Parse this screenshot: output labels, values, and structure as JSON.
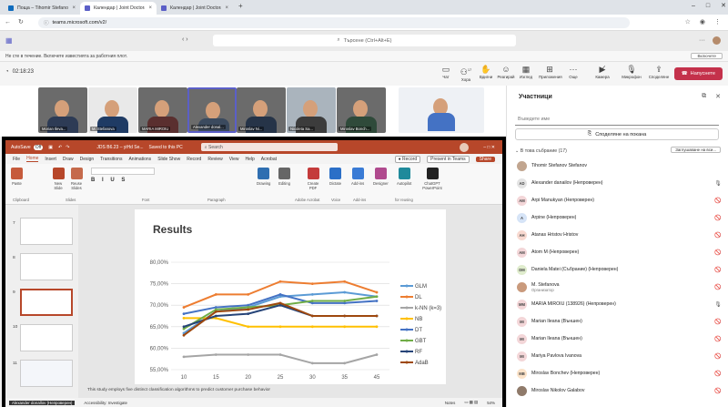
{
  "browser": {
    "tabs": [
      {
        "label": "Поща – Tihomir Stefanov Stefa",
        "active": false,
        "color": "#0f6cbd"
      },
      {
        "label": "Календар | Joint Doctoral T",
        "active": true,
        "color": "#5b5fc7"
      },
      {
        "label": "Календар | Joint Doctoral T",
        "active": false,
        "color": "#5b5fc7"
      }
    ],
    "new_tab": "+",
    "url": "teams.microsoft.com/v2/",
    "window_controls": [
      "–",
      "□",
      "✕"
    ]
  },
  "teams": {
    "search_placeholder": "Търсене (Ctrl+Alt+E)",
    "notice": "Не сте в течение. Включете известията за работния плот.",
    "notice_button": "Включете"
  },
  "meeting": {
    "timer": "02:18:23",
    "toolbar": [
      {
        "label": "Чат",
        "icon": "chat-icon"
      },
      {
        "label": "Хора",
        "icon": "people-icon",
        "badge": "17"
      },
      {
        "label": "Вдигни",
        "icon": "raise-hand-icon"
      },
      {
        "label": "Реагирай",
        "icon": "react-icon"
      },
      {
        "label": "Изглед",
        "icon": "view-icon"
      },
      {
        "label": "Приложения",
        "icon": "apps-icon"
      },
      {
        "label": "Още",
        "icon": "more-icon"
      },
      {
        "label": "Камера",
        "icon": "camera-icon"
      },
      {
        "label": "Микрофон",
        "icon": "mic-icon"
      },
      {
        "label": "Споделяне",
        "icon": "share-icon"
      }
    ],
    "leave_label": "Напуснете",
    "videos": [
      {
        "name": "Morian Ileva...",
        "bg": "#5e6d7a"
      },
      {
        "name": "M. Stefanova",
        "bg": "#d9d9d9"
      },
      {
        "name": "MARIA MIROIU",
        "bg": "#7a6a5c"
      },
      {
        "name": "Alexander donal...",
        "bg": "#8a8f95"
      },
      {
        "name": "Miroslav Ni...",
        "bg": "#6f7b86"
      },
      {
        "name": "Nicoleta Sa...",
        "bg": "#a8b1ba"
      },
      {
        "name": "Miroslav Bonch...",
        "bg": "#7d8a74"
      },
      {
        "name": "",
        "bg": "#f2f2f2"
      }
    ]
  },
  "powerpoint": {
    "autosave": "AutoSave",
    "autosave_state": "Off",
    "filename": "JDS B6.23 – yiHd Se...",
    "saved": "Saved to this PC",
    "search": "Search",
    "menu": [
      "File",
      "Home",
      "Insert",
      "Draw",
      "Design",
      "Transitions",
      "Animations",
      "Slide Show",
      "Record",
      "Review",
      "View",
      "Help",
      "Acrobat"
    ],
    "record_btn": "Record",
    "present_btn": "Present in Teams",
    "share_btn": "Share",
    "ribbon_groups": [
      {
        "label": "Paste",
        "color": "#c65b3c"
      },
      {
        "label": "New Slide",
        "color": "#b7472a"
      },
      {
        "label": "Reuse Slides",
        "color": "#c56a4b"
      },
      {
        "label": "Drawing",
        "color": "#2f6fb1"
      },
      {
        "label": "Editing",
        "color": "#666666"
      },
      {
        "label": "Create PDF",
        "color": "#c43b3b"
      },
      {
        "label": "Dictate",
        "color": "#2b6fc7"
      },
      {
        "label": "Add-ins",
        "color": "#3a7bd5"
      },
      {
        "label": "Designer",
        "color": "#b04a8e"
      },
      {
        "label": "Autopilot",
        "color": "#1f8a9b"
      },
      {
        "label": "ChatGPT PowerPoint",
        "color": "#222222"
      }
    ],
    "ribbon_sections": [
      "Clipboard",
      "Slides",
      "Font",
      "Paragraph",
      "Adobe Acrobat",
      "Voice",
      "Add-ins",
      "for reusing"
    ],
    "thumbs": [
      "7",
      "8",
      "9",
      "10",
      "11"
    ],
    "selected_thumb": "9",
    "slide_title": "Results",
    "note": "This study employs five distinct classification algorithms to predict customer purchase behavior",
    "status_left": "Alexander donallov (Непроверен)",
    "status_accessibility": "Accessibility: Investigate",
    "status_notes": "Notes",
    "status_zoom": "54%"
  },
  "chart_data": {
    "type": "line",
    "x": [
      10,
      15,
      20,
      25,
      30,
      35,
      45
    ],
    "ylim": [
      55,
      80
    ],
    "yticks": [
      "55,00%",
      "60,00%",
      "65,00%",
      "70,00%",
      "75,00%",
      "80,00%"
    ],
    "legend_position": "right",
    "series": [
      {
        "name": "GLM",
        "color": "#5b9bd5",
        "values": [
          63.5,
          68.5,
          69.5,
          72,
          72.5,
          73,
          72
        ]
      },
      {
        "name": "DL",
        "color": "#ed7d31",
        "values": [
          69.5,
          72.5,
          72.5,
          75.5,
          75,
          75.5,
          73
        ]
      },
      {
        "name": "k-NN (k=3)",
        "color": "#a5a5a5",
        "values": [
          58,
          58.5,
          58.5,
          58.5,
          56.5,
          56.5,
          58.5
        ]
      },
      {
        "name": "NB",
        "color": "#ffc000",
        "values": [
          67,
          67,
          65,
          65,
          65,
          65,
          65
        ]
      },
      {
        "name": "DT",
        "color": "#4472c4",
        "values": [
          68,
          69.5,
          70,
          72.5,
          70.5,
          70.5,
          71
        ]
      },
      {
        "name": "GBT",
        "color": "#70ad47",
        "values": [
          64.5,
          69,
          69.5,
          70,
          71,
          71,
          72
        ]
      },
      {
        "name": "RF",
        "color": "#264478",
        "values": [
          65,
          67.5,
          68,
          70,
          67.5,
          67.5,
          67.5
        ]
      },
      {
        "name": "AdaB",
        "color": "#9e480e",
        "values": [
          63,
          68.5,
          69,
          70.5,
          67.5,
          67.5,
          67.5
        ]
      }
    ]
  },
  "panel": {
    "title": "Участници",
    "invite_placeholder": "Въведете име",
    "share_invite": "Споделяне на покана",
    "section_label": "В това събрание (17)",
    "admit_all": "Заглушаване на вси...",
    "people": [
      {
        "name": "Tihomir Stefanov Stefanov",
        "initials": "",
        "sub": "",
        "av_bg": "#c1a58f",
        "mic": ""
      },
      {
        "name": "Alexander danailov (Непроверен)",
        "initials": "AD",
        "sub": "",
        "av_bg": "#e3e3e3",
        "mic": "🎙"
      },
      {
        "name": "Arpi Manukyan (Непроверен)",
        "initials": "AM",
        "sub": "",
        "av_bg": "#f3d6d8",
        "mic": "🚫"
      },
      {
        "name": "Arpine (Непроверен)",
        "initials": "A",
        "sub": "",
        "av_bg": "#d6e4f7",
        "mic": "🚫"
      },
      {
        "name": "Atanas Hristov Hristov",
        "initials": "AH",
        "sub": "",
        "av_bg": "#f8d9d0",
        "mic": "🚫"
      },
      {
        "name": "Atom M (Непроверен)",
        "initials": "AM",
        "sub": "",
        "av_bg": "#f3d6d8",
        "mic": "🚫"
      },
      {
        "name": "Daniela Matei (Събрание) (Непроверен)",
        "initials": "DM",
        "sub": "",
        "av_bg": "#dfeccd",
        "mic": "🚫"
      },
      {
        "name": "M. Stefanova",
        "initials": "",
        "sub": "Организатор",
        "av_bg": "#c99a7c",
        "mic": "🚫"
      },
      {
        "name": "MARIA MIROIU (138926) (Непроверен)",
        "initials": "MM",
        "sub": "",
        "av_bg": "#f3d6d8",
        "mic": "🎙"
      },
      {
        "name": "Marian Ileana (Външен)",
        "initials": "MI",
        "sub": "",
        "av_bg": "#f3d6d8",
        "mic": "🚫"
      },
      {
        "name": "Marian Ileana (Външен)",
        "initials": "MI",
        "sub": "",
        "av_bg": "#f3d6d8",
        "mic": "🚫"
      },
      {
        "name": "Mariya Pavlova Ivanova",
        "initials": "MI",
        "sub": "",
        "av_bg": "#f3d6d8",
        "mic": "🚫"
      },
      {
        "name": "Miroslav Bonchev (Непроверен)",
        "initials": "MB",
        "sub": "",
        "av_bg": "#fbe2c8",
        "mic": "🚫"
      },
      {
        "name": "Miroslav Nikolov Galabov",
        "initials": "",
        "sub": "",
        "av_bg": "#8f7a6a",
        "mic": "🚫"
      }
    ]
  }
}
